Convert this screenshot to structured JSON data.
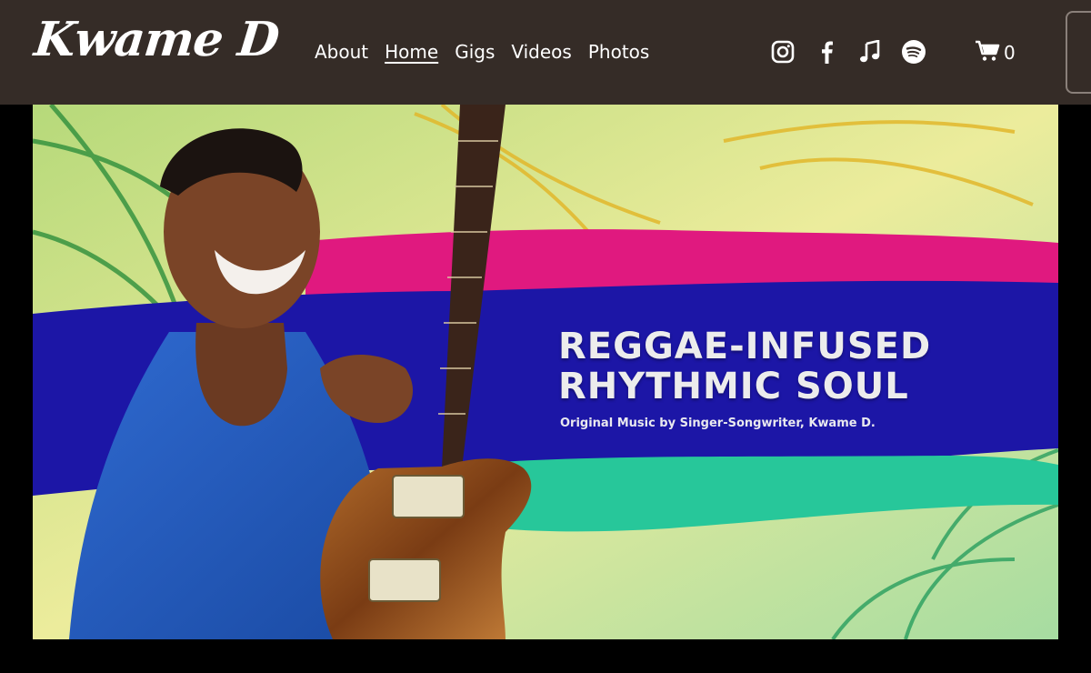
{
  "brand": {
    "logo_text": "Kwame D"
  },
  "nav": {
    "items": [
      {
        "label": "About",
        "active": false
      },
      {
        "label": "Home",
        "active": true
      },
      {
        "label": "Gigs",
        "active": false
      },
      {
        "label": "Videos",
        "active": false
      },
      {
        "label": "Photos",
        "active": false
      }
    ]
  },
  "social": {
    "icons": [
      "instagram-icon",
      "facebook-icon",
      "music-note-icon",
      "spotify-icon"
    ]
  },
  "cart": {
    "count": "0"
  },
  "hero": {
    "title_line1": "REGGAE-INFUSED",
    "title_line2": "RHYTHMIC SOUL",
    "subtitle": "Original Music by Singer-Songwriter, Kwame D."
  },
  "colors": {
    "header_bg": "#352c27",
    "page_bg": "#000000",
    "magenta_band": "#e0197f",
    "blue_band": "#1c16a6",
    "teal_band": "#27c79a"
  }
}
